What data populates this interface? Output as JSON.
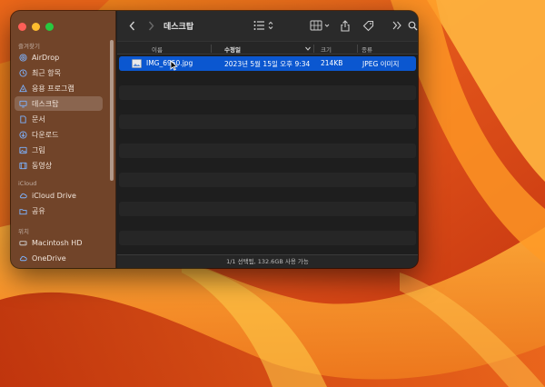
{
  "window": {
    "title": "데스크탑"
  },
  "colors": {
    "traffic_close": "#ff5f57",
    "traffic_minimize": "#febc2e",
    "traffic_zoom": "#28c840",
    "selection": "#0b57d0"
  },
  "sidebar": {
    "sections": [
      {
        "label": "즐겨찾기",
        "items": [
          {
            "label": "AirDrop",
            "icon": "airdrop-icon"
          },
          {
            "label": "최근 항목",
            "icon": "clock-icon"
          },
          {
            "label": "응용 프로그램",
            "icon": "applications-icon"
          },
          {
            "label": "데스크탑",
            "icon": "desktop-icon",
            "selected": true
          },
          {
            "label": "문서",
            "icon": "document-icon"
          },
          {
            "label": "다운로드",
            "icon": "download-icon"
          },
          {
            "label": "그림",
            "icon": "photo-icon"
          },
          {
            "label": "동영상",
            "icon": "movie-icon"
          }
        ]
      },
      {
        "label": "iCloud",
        "items": [
          {
            "label": "iCloud Drive",
            "icon": "cloud-icon"
          },
          {
            "label": "공유",
            "icon": "shared-folder-icon"
          }
        ]
      },
      {
        "label": "위치",
        "items": [
          {
            "label": "Macintosh HD",
            "icon": "harddisk-icon"
          },
          {
            "label": "OneDrive",
            "icon": "cloud-icon"
          }
        ]
      }
    ]
  },
  "columns": {
    "name": "이름",
    "date": "수정일",
    "size": "크기",
    "kind": "종류"
  },
  "files": [
    {
      "name": "IMG_6950.jpg",
      "date": "2023년 5월 15일 오후 9:34",
      "size": "214KB",
      "kind": "JPEG 이미지",
      "selected": true
    }
  ],
  "status": "1/1 선택됨, 132.6GB 사용 가능"
}
